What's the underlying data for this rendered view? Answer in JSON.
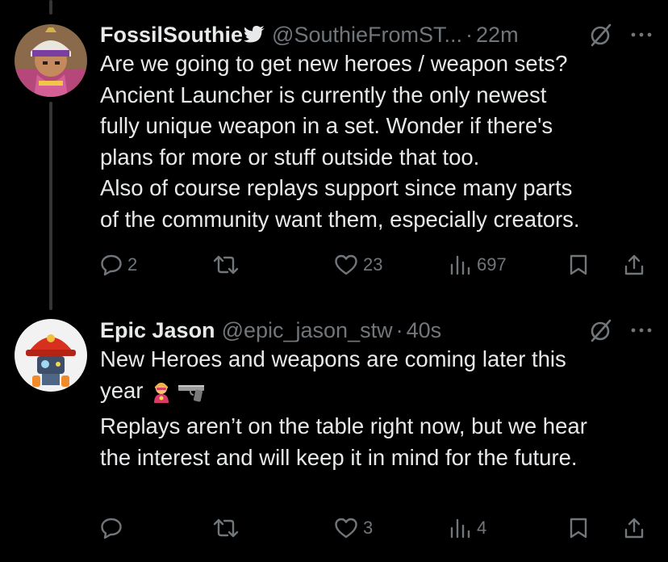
{
  "tweets": [
    {
      "name": "FossilSouthie",
      "handle": "@SouthieFromST...",
      "separator": "·",
      "time": "22m",
      "text": "Are we going to get new heroes / weapon sets?\nAncient Launcher is currently the only newest\nfully unique weapon in a set. Wonder if there's\nplans for more or stuff outside that too.\nAlso of course replays support since many parts\nof the community want them, especially creators.",
      "verified_icon": "bird-icon",
      "stats": {
        "replies": "2",
        "retweets": "",
        "likes": "23",
        "views": "697"
      }
    },
    {
      "name": "Epic Jason",
      "handle": "@epic_jason_stw",
      "separator": "·",
      "time": "40s",
      "text_line1": "New Heroes and weapons are coming later this",
      "text_line2": "year",
      "emojis": [
        "superhero-emoji",
        "pistol-emoji"
      ],
      "text_rest": "\nReplays aren’t on the table right now, but we hear\nthe interest and will keep it in mind for the future.",
      "stats": {
        "replies": "",
        "retweets": "",
        "likes": "3",
        "views": "4"
      }
    }
  ],
  "colors": {
    "background": "#000000",
    "text": "#e7e9ea",
    "muted": "#71767b",
    "thread_line": "#333639"
  }
}
